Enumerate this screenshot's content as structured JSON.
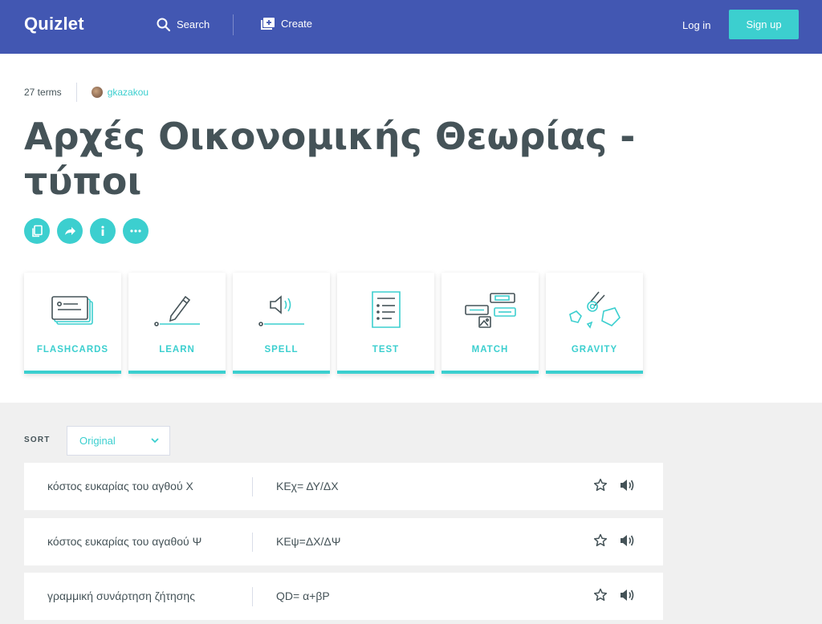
{
  "header": {
    "logo": "Quizlet",
    "search_label": "Search",
    "create_label": "Create",
    "login_label": "Log in",
    "signup_label": "Sign up"
  },
  "set": {
    "term_count": "27 terms",
    "author": "gkazakou",
    "title": "Αρχές Οικονομικής Θεωρίας - τύποι"
  },
  "actions": [
    {
      "icon": "copy-icon"
    },
    {
      "icon": "share-icon"
    },
    {
      "icon": "info-icon"
    },
    {
      "icon": "more-icon"
    }
  ],
  "modes": [
    {
      "label": "FLASHCARDS",
      "icon": "flashcards-icon"
    },
    {
      "label": "LEARN",
      "icon": "learn-icon"
    },
    {
      "label": "SPELL",
      "icon": "spell-icon"
    },
    {
      "label": "TEST",
      "icon": "test-icon"
    },
    {
      "label": "MATCH",
      "icon": "match-icon"
    },
    {
      "label": "GRAVITY",
      "icon": "gravity-icon"
    }
  ],
  "sort": {
    "label": "SORT",
    "selected": "Original"
  },
  "terms": [
    {
      "term": "κόστος ευκαρίας του αγθού Χ",
      "definition": "ΚΕχ= ΔΥ/ΔΧ"
    },
    {
      "term": "κόστος ευκαρίας του αγαθού Ψ",
      "definition": "ΚΕψ=ΔΧ/ΔΨ"
    },
    {
      "term": "γραμμική συνάρτηση ζήτησης",
      "definition": "QD= α+βP"
    }
  ],
  "colors": {
    "brand": "#4257b2",
    "accent": "#3ccfcf",
    "text": "#455358",
    "background_alt": "#f0f0f0"
  }
}
